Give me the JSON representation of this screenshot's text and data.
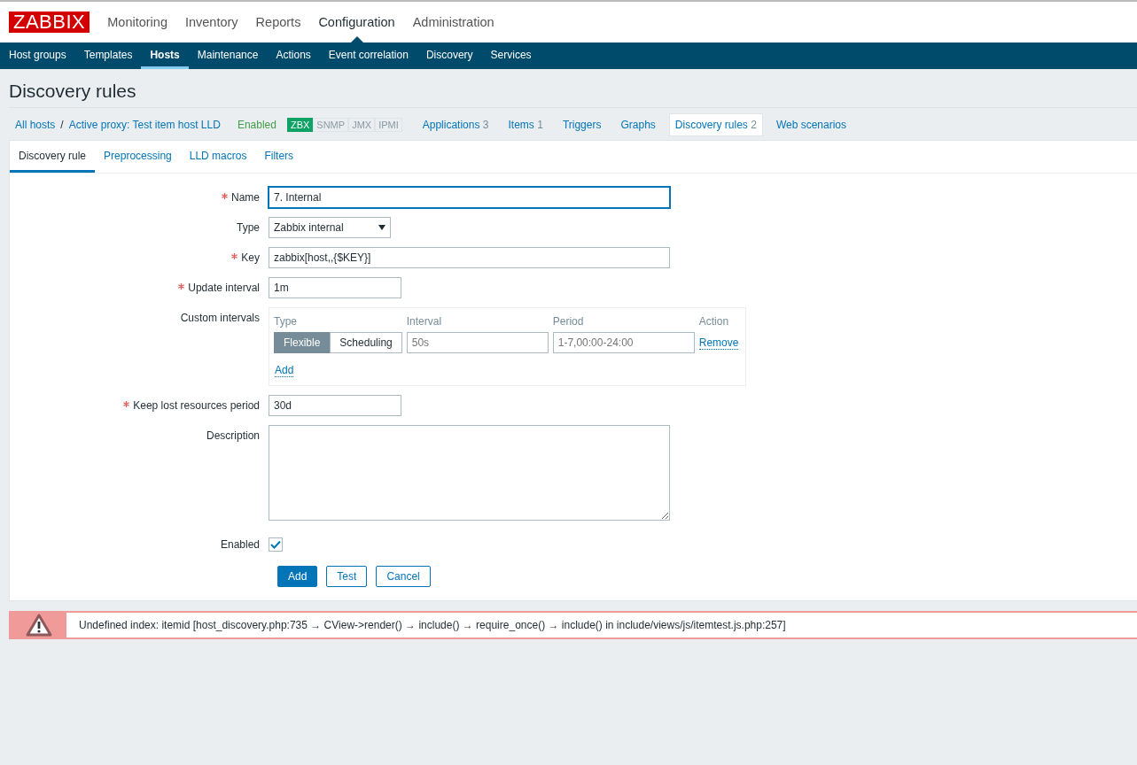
{
  "logo": "ZABBIX",
  "main_menu": [
    {
      "label": "Monitoring",
      "selected": false
    },
    {
      "label": "Inventory",
      "selected": false
    },
    {
      "label": "Reports",
      "selected": false
    },
    {
      "label": "Configuration",
      "selected": true
    },
    {
      "label": "Administration",
      "selected": false
    }
  ],
  "sub_menu": [
    {
      "label": "Host groups",
      "selected": false
    },
    {
      "label": "Templates",
      "selected": false
    },
    {
      "label": "Hosts",
      "selected": true
    },
    {
      "label": "Maintenance",
      "selected": false
    },
    {
      "label": "Actions",
      "selected": false
    },
    {
      "label": "Event correlation",
      "selected": false
    },
    {
      "label": "Discovery",
      "selected": false
    },
    {
      "label": "Services",
      "selected": false
    }
  ],
  "page_title": "Discovery rules",
  "breadcrumbs": [
    {
      "label": "All hosts"
    },
    {
      "label": "Active proxy: Test item host LLD"
    }
  ],
  "breadcrumb_separator": "/",
  "host_status": "Enabled",
  "availability": [
    {
      "label": "ZBX",
      "on": true
    },
    {
      "label": "SNMP",
      "on": false
    },
    {
      "label": "JMX",
      "on": false
    },
    {
      "label": "IPMI",
      "on": false
    }
  ],
  "host_tabs": [
    {
      "label": "Applications",
      "count": "3",
      "selected": false
    },
    {
      "label": "Items",
      "count": "1",
      "selected": false
    },
    {
      "label": "Triggers",
      "selected": false
    },
    {
      "label": "Graphs",
      "selected": false
    },
    {
      "label": "Discovery rules",
      "count": "2",
      "selected": true
    },
    {
      "label": "Web scenarios",
      "selected": false
    }
  ],
  "form_tabs": [
    {
      "label": "Discovery rule",
      "selected": true
    },
    {
      "label": "Preprocessing",
      "selected": false
    },
    {
      "label": "LLD macros",
      "selected": false
    },
    {
      "label": "Filters",
      "selected": false
    }
  ],
  "fields": [
    {
      "kind": "wide_text",
      "label": "Name",
      "required": true,
      "value": "7. Internal"
    },
    {
      "kind": "select",
      "label": "Type",
      "required": false,
      "value": "Zabbix internal"
    },
    {
      "kind": "wide_text",
      "label": "Key",
      "required": true,
      "value": "zabbix[host,,{$KEY}]"
    },
    {
      "kind": "short_text",
      "label": "Update interval",
      "required": true,
      "value": "1m"
    },
    {
      "kind": "intervals",
      "label": "Custom intervals",
      "required": false,
      "columns": [
        "Type",
        "Interval",
        "Period",
        "Action"
      ],
      "rows": [
        {
          "modes": [
            {
              "label": "Flexible",
              "selected": true
            },
            {
              "label": "Scheduling",
              "selected": false
            }
          ],
          "interval_placeholder": "50s",
          "period_placeholder": "1-7,00:00-24:00",
          "action": "Remove"
        }
      ],
      "add": "Add"
    },
    {
      "kind": "short_text",
      "label": "Keep lost resources period",
      "required": true,
      "value": "30d"
    },
    {
      "kind": "textarea",
      "label": "Description",
      "required": false
    },
    {
      "kind": "checkbox",
      "label": "Enabled",
      "required": false,
      "checked": true
    }
  ],
  "buttons": [
    {
      "label": "Add",
      "primary": true
    },
    {
      "label": "Test",
      "primary": false
    },
    {
      "label": "Cancel",
      "primary": false
    }
  ],
  "error": "Undefined index: itemid [host_discovery.php:735 → CView->render() → include() → require_once() → include() in include/views/js/itemtest.js.php:257]"
}
